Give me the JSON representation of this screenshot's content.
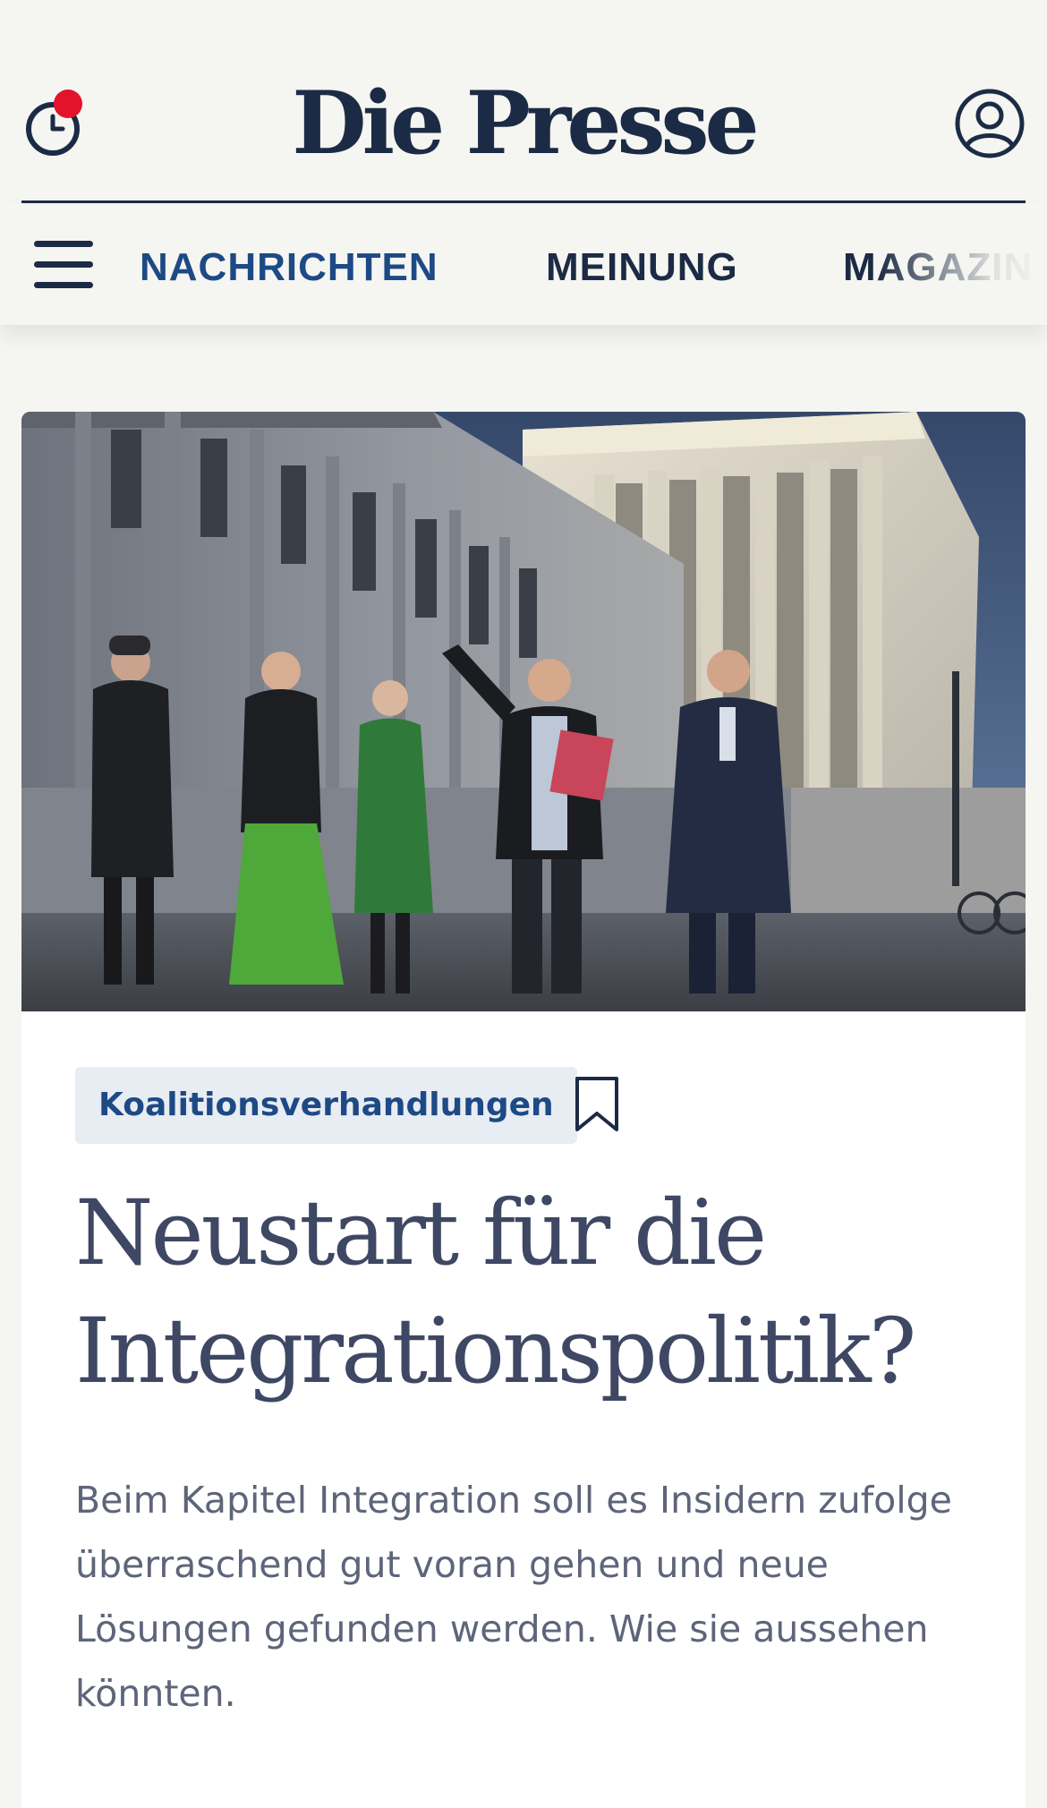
{
  "header": {
    "logo": "Die Presse",
    "history_icon": "clock-history-icon",
    "notification_dot_color": "#e3132b",
    "account_icon": "user-account-icon"
  },
  "nav": {
    "menu_icon": "hamburger-menu-icon",
    "items": [
      {
        "label": "NACHRICHTEN",
        "active": true
      },
      {
        "label": "MEINUNG",
        "active": false
      },
      {
        "label": "MAGAZIN",
        "active": false
      }
    ]
  },
  "article": {
    "image_alt": "Verhandler verlassen das Parlament in Wien",
    "tag": "Koalitionsverhandlungen",
    "bookmark_icon": "bookmark-icon",
    "headline": "Neustart für die Integrationspolitik?",
    "lead": "Beim Kapitel Integration soll es Insidern zufolge überraschend gut voran gehen und neue Lösungen gefunden werden. Wie sie aussehen könnten."
  },
  "colors": {
    "brand_navy": "#1c2b45",
    "accent_blue": "#1d4a85",
    "tag_background": "#e8ecf3",
    "page_background": "#f5f5f1"
  }
}
